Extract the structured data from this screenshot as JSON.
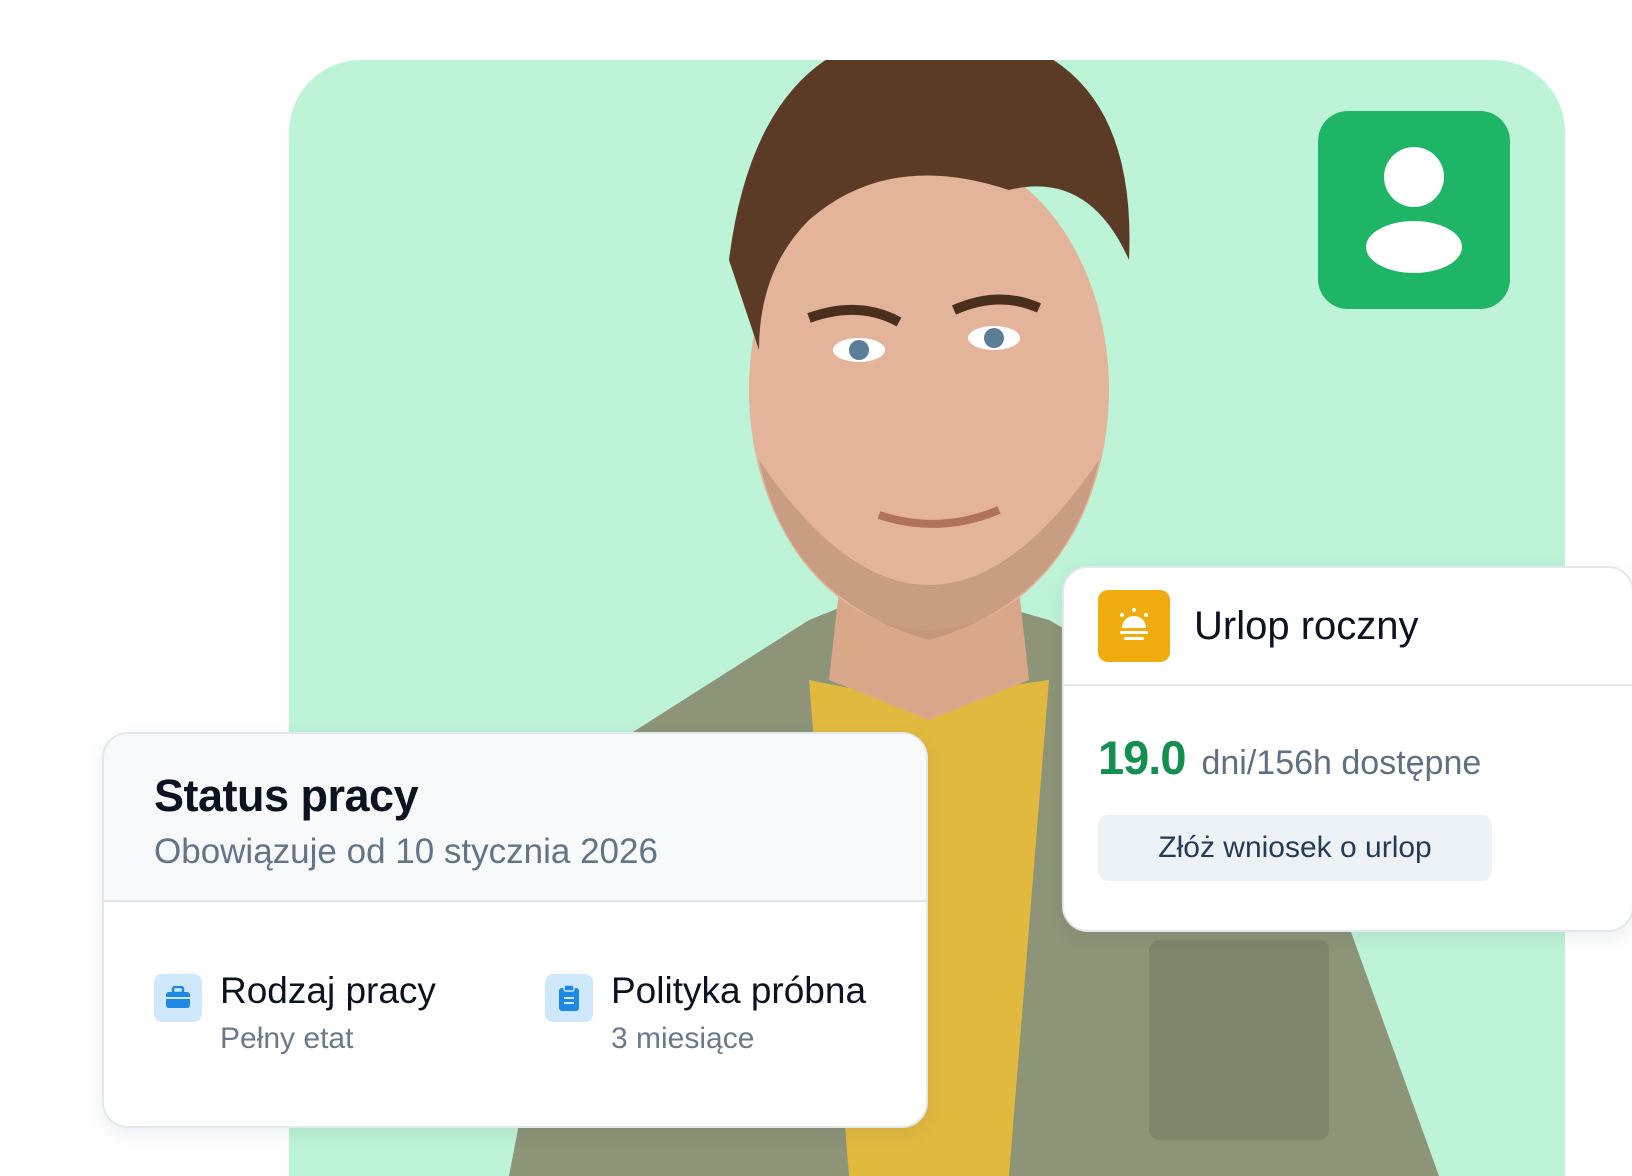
{
  "status_card": {
    "title": "Status pracy",
    "subtitle": "Obowiązuje od 10 stycznia 2026",
    "items": [
      {
        "label": "Rodzaj pracy",
        "value": "Pełny etat",
        "icon": "briefcase-icon"
      },
      {
        "label": "Polityka próbna",
        "value": "3 miesiące",
        "icon": "clipboard-icon"
      }
    ]
  },
  "leave_card": {
    "title": "Urlop roczny",
    "icon": "sun-icon",
    "value": "19.0",
    "description": "dni/156h dostępne",
    "button_label": "Złóż wniosek o urlop"
  },
  "colors": {
    "panel_background": "#bdf3d6",
    "badge_green": "#1fb566",
    "leave_value_green": "#13904f",
    "sun_icon_bg": "#f0ac0f"
  }
}
